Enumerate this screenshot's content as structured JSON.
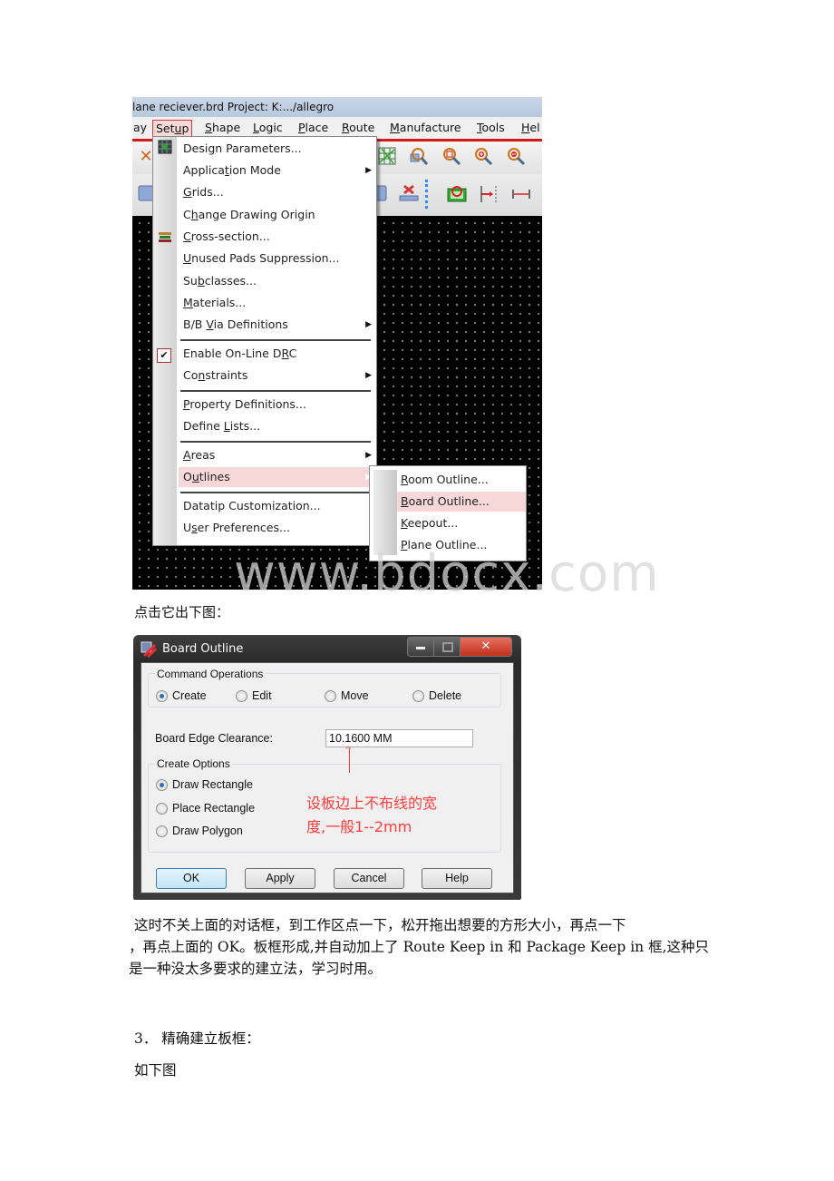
{
  "allegro_window": {
    "title": "lane reciever.brd  Project: K:.../allegro",
    "menubar": [
      {
        "label": "ay",
        "accel": null
      },
      {
        "label": "Setup",
        "accel": 3,
        "active": true
      },
      {
        "label": "Shape",
        "accel": 0
      },
      {
        "label": "Logic",
        "accel": 0
      },
      {
        "label": "Place",
        "accel": 0
      },
      {
        "label": "Route",
        "accel": 0
      },
      {
        "label": "Manufacture",
        "accel": 0
      },
      {
        "label": "Tools",
        "accel": 0
      },
      {
        "label": "Hel",
        "accel": 0
      }
    ],
    "toolbar_icons": [
      "delete-x-icon",
      "grid-snap-icon",
      "zoom-fit-icon",
      "zoom-window-icon",
      "zoom-in-icon",
      "zoom-out-icon",
      "blue-rect-icon",
      "delete-layer-icon",
      "pcb-board-icon",
      "dimension-arrow-icon",
      "dimension-line-icon"
    ],
    "setup_menu": {
      "items": [
        {
          "label": "Design Parameters...",
          "icon": "design-parameters-icon"
        },
        {
          "label": "Application Mode",
          "submenu": true
        },
        {
          "label": "Grids..."
        },
        {
          "label": "Change Drawing Origin"
        },
        {
          "label": "Cross-section...",
          "icon": "cross-section-icon"
        },
        {
          "label": "Unused Pads Suppression..."
        },
        {
          "label": "Subclasses..."
        },
        {
          "label": "Materials..."
        },
        {
          "label": "B/B Via Definitions",
          "submenu": true
        },
        {
          "label": "Enable On-Line DRC",
          "checked": true
        },
        {
          "label": "Constraints",
          "submenu": true
        },
        {
          "label": "Property Definitions..."
        },
        {
          "label": "Define Lists..."
        },
        {
          "label": "Areas",
          "submenu": true
        },
        {
          "label": "Outlines",
          "submenu": true,
          "highlighted": true
        },
        {
          "label": "Datatip Customization..."
        },
        {
          "label": "User Preferences..."
        }
      ]
    },
    "outlines_submenu": {
      "items": [
        {
          "label": "Room Outline..."
        },
        {
          "label": "Board Outline...",
          "highlighted": true
        },
        {
          "label": "Keepout..."
        },
        {
          "label": "Plane Outline..."
        }
      ]
    }
  },
  "watermark": "www.bdocx.com",
  "caption_1": "点击它出下图：",
  "board_outline_dialog": {
    "title": "Board Outline",
    "command_operations": {
      "label": "Command Operations",
      "options": [
        {
          "label": "Create",
          "selected": true
        },
        {
          "label": "Edit",
          "selected": false
        },
        {
          "label": "Move",
          "selected": false
        },
        {
          "label": "Delete",
          "selected": false
        }
      ]
    },
    "board_edge_clearance": {
      "label": "Board Edge Clearance:",
      "value": "10.1600 MM"
    },
    "create_options": {
      "label": "Create Options",
      "options": [
        {
          "label": "Draw Rectangle",
          "selected": true
        },
        {
          "label": "Place Rectangle",
          "selected": false
        },
        {
          "label": "Draw Polygon",
          "selected": false
        }
      ]
    },
    "annotation": {
      "line1": "设板边上不布线的宽",
      "line2": "度,一般1--2mm",
      "color": "#ff3b3b"
    },
    "buttons": {
      "ok": "OK",
      "apply": "Apply",
      "cancel": "Cancel",
      "help": "Help"
    }
  },
  "paragraph": {
    "line1": "这时不关上面的对话框，到工作区点一下，松开拖出想要的方形大小，再点一下",
    "line2": "，再点上面的 OK。板框形成,并自动加上了 Route Keep in 和 Package Keep in 框,这种只",
    "line3": "是一种没太多要求的建立法，学习时用。"
  },
  "section_heading": "3．  精确建立板框：",
  "caption_2": "如下图"
}
